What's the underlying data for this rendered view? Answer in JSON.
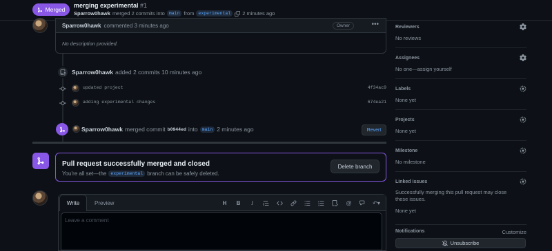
{
  "header": {
    "badge_label": "Merged",
    "title": "merging experimental",
    "number": "#1",
    "author": "Sparrow0hawk",
    "merged_text": "merged 2 commits into",
    "base_branch": "main",
    "from_text": "from",
    "head_branch": "experimental",
    "time": "2 minutes ago"
  },
  "comment": {
    "author": "Sparrow0hawk",
    "action": "commented 3 minutes ago",
    "owner_badge": "Owner",
    "body": "No description provided."
  },
  "commits_event": {
    "author": "Sparrow0hawk",
    "text": "added 2 commits 10 minutes ago",
    "commits": [
      {
        "message": "updated project",
        "sha": "4f34ac9"
      },
      {
        "message": "adding experimental changes",
        "sha": "674ea21"
      }
    ]
  },
  "merge_event": {
    "author": "Sparrow0hawk",
    "merged_commit_text": "merged commit",
    "sha": "b0944ed",
    "into_text": "into",
    "branch": "main",
    "time": "2 minutes ago",
    "revert_label": "Revert"
  },
  "merge_box": {
    "title": "Pull request successfully merged and closed",
    "sub_prefix": "You're all set—the",
    "branch": "experimental",
    "sub_suffix": "branch can be safely deleted.",
    "delete_label": "Delete branch"
  },
  "editor": {
    "tab_write": "Write",
    "tab_preview": "Preview",
    "placeholder": "Leave a comment",
    "tools": {
      "heading": "H",
      "bold": "B",
      "italic": "I"
    }
  },
  "sidebar": {
    "reviewers": {
      "title": "Reviewers",
      "value": "No reviews"
    },
    "assignees": {
      "title": "Assignees",
      "value": "No one—assign yourself"
    },
    "labels": {
      "title": "Labels",
      "value": "None yet"
    },
    "projects": {
      "title": "Projects",
      "value": "None yet"
    },
    "milestone": {
      "title": "Milestone",
      "value": "No milestone"
    },
    "linked_issues": {
      "title": "Linked issues",
      "value": "Successfully merging this pull request may close these issues.",
      "value2": "None yet"
    },
    "notifications": {
      "title": "Notifications",
      "customize": "Customize",
      "unsubscribe": "Unsubscribe"
    }
  },
  "colors": {
    "merged_purple": "#8957e5",
    "link_blue": "#58a6ff",
    "background": "#0d1117"
  }
}
